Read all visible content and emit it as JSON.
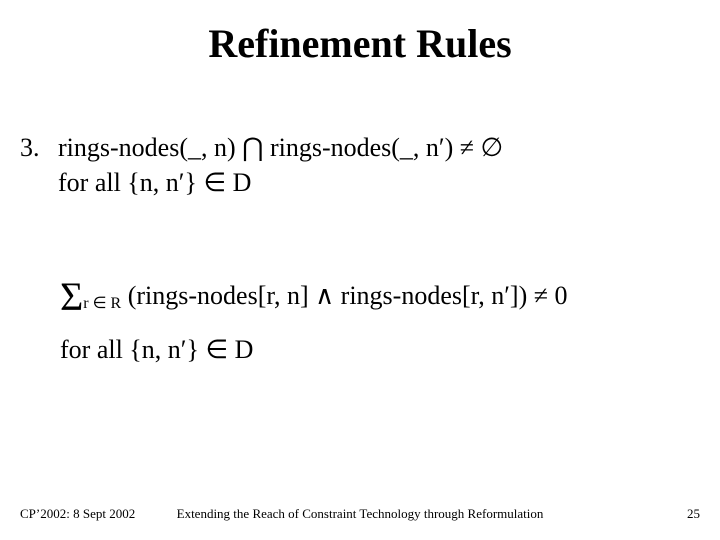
{
  "title": "Refinement Rules",
  "rule": {
    "number": "3.",
    "line1": "rings-nodes(_, n) ⋂  rings-nodes(_, n′)  ≠  ∅",
    "line2": "for all {n, n′} ∈ D"
  },
  "sum": {
    "sigma": "Σ",
    "sub": "r ∈ R",
    "expr": " (rings-nodes[r, n] ∧ rings-nodes[r, n′]) ≠ 0",
    "cond": "for all {n, n′} ∈ D"
  },
  "footer": {
    "left": "CP’2002: 8 Sept 2002",
    "center": "Extending the Reach of Constraint Technology through Reformulation",
    "right": "25"
  }
}
